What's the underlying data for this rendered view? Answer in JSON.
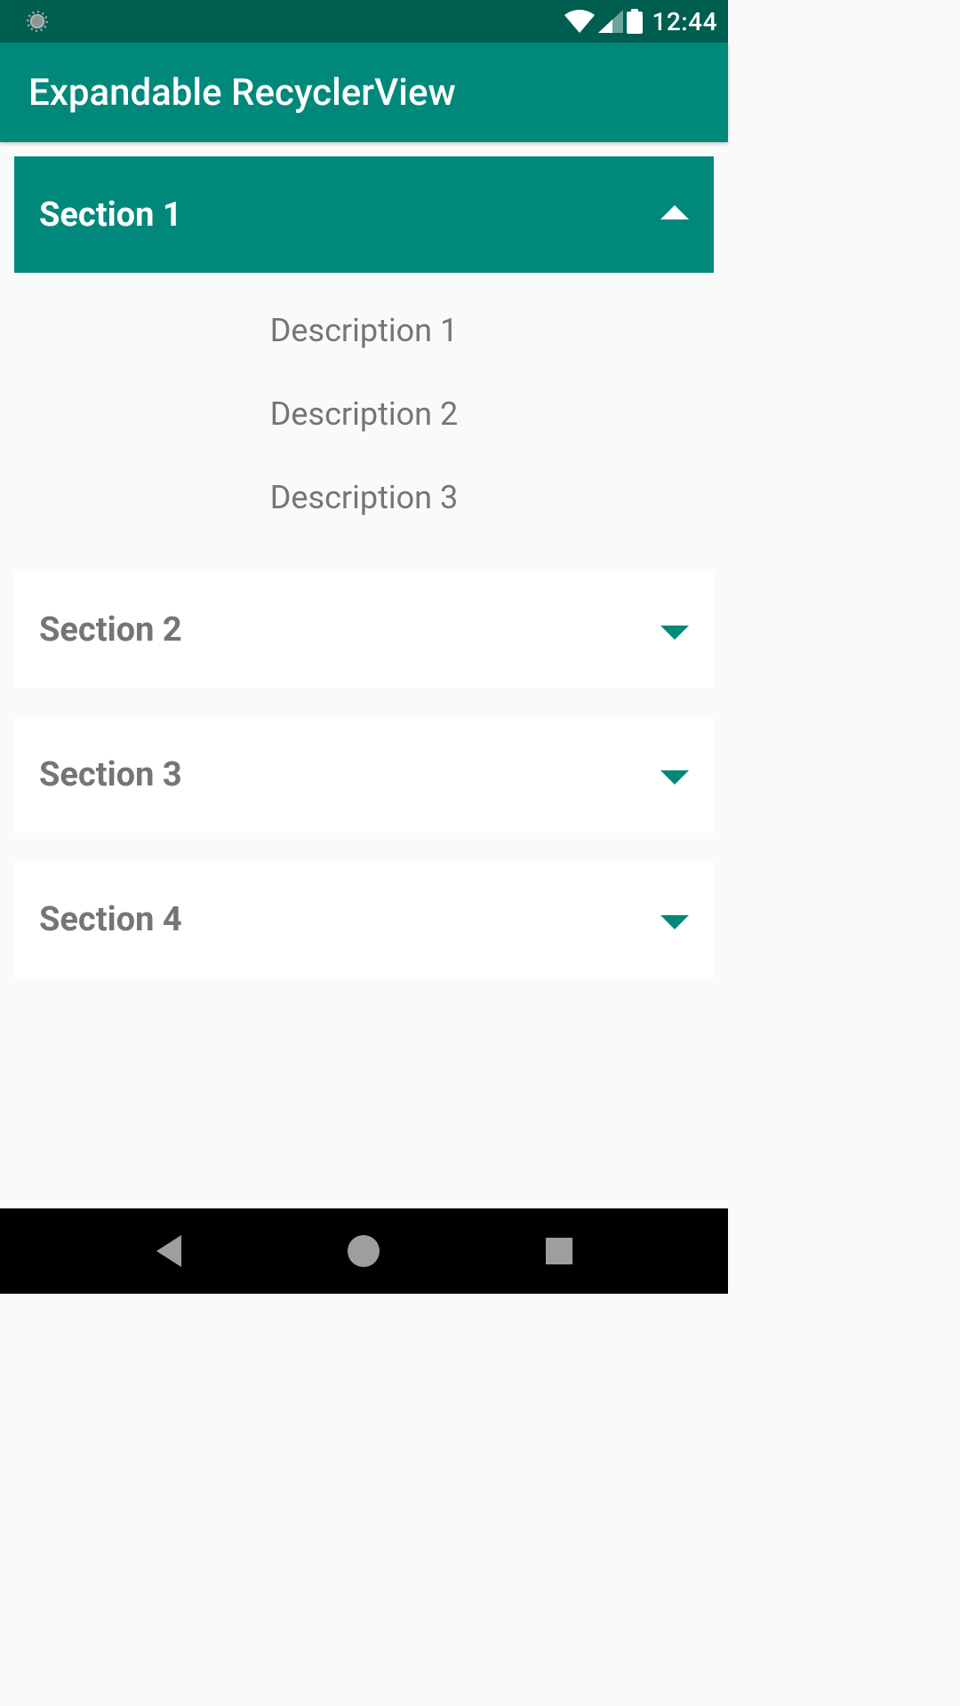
{
  "status_bar": {
    "clock": "12:44"
  },
  "app_bar": {
    "title": "Expandable RecyclerView"
  },
  "sections": [
    {
      "title": "Section 1",
      "expanded": true,
      "items": [
        {
          "label": "Description 1"
        },
        {
          "label": "Description 2"
        },
        {
          "label": "Description 3"
        }
      ]
    },
    {
      "title": "Section 2",
      "expanded": false
    },
    {
      "title": "Section 3",
      "expanded": false
    },
    {
      "title": "Section 4",
      "expanded": false
    }
  ],
  "colors": {
    "primary": "#00897b",
    "primary_dark": "#005e51",
    "text_muted": "#757575",
    "bg": "#fafafa"
  }
}
